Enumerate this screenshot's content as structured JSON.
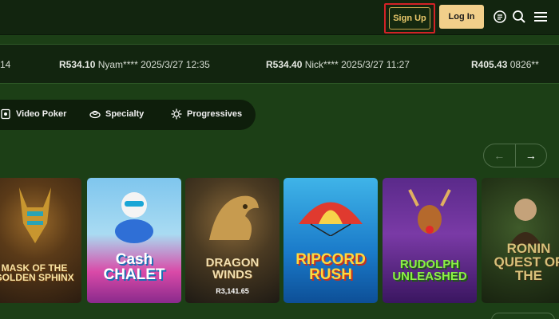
{
  "header": {
    "signup_label": "Sign Up",
    "login_label": "Log In",
    "icons": [
      "chat-icon",
      "search-icon",
      "menu-icon"
    ]
  },
  "ticker": {
    "items": [
      {
        "amount": "",
        "text": "14"
      },
      {
        "amount": "R534.10",
        "text": "Nyam**** 2025/3/27 12:35"
      },
      {
        "amount": "R534.40",
        "text": "Nick**** 2025/3/27 11:27"
      },
      {
        "amount": "R405.43",
        "text": "0826**"
      }
    ]
  },
  "categories": [
    {
      "label": "Video Poker",
      "icon": "video-poker-icon"
    },
    {
      "label": "Specialty",
      "icon": "specialty-icon"
    },
    {
      "label": "Progressives",
      "icon": "progressives-icon"
    }
  ],
  "games": [
    {
      "title": "MASK OF THE GOLDEN SPHINX",
      "jackpot": ""
    },
    {
      "title": "Cash CHALET",
      "jackpot": ""
    },
    {
      "title": "DRAGON WINDS",
      "jackpot": "R3,141.65"
    },
    {
      "title": "RIPCORD RUSH",
      "jackpot": ""
    },
    {
      "title": "RUDOLPH UNLEASHED",
      "jackpot": ""
    },
    {
      "title": "RONIN QUEST OF THE",
      "jackpot": ""
    }
  ],
  "colors": {
    "background": "#1c3f16",
    "topbar": "#12250f",
    "login_bg": "#f2cf8a",
    "signup_border": "#d32226"
  }
}
